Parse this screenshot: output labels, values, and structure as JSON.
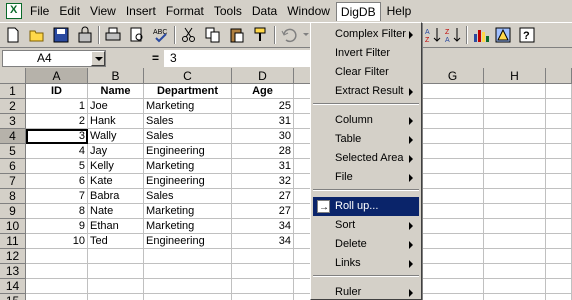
{
  "menubar": {
    "items": [
      "File",
      "Edit",
      "View",
      "Insert",
      "Format",
      "Tools",
      "Data",
      "Window",
      "DigDB",
      "Help"
    ],
    "active_index": 8
  },
  "formula": {
    "cell_ref": "A4",
    "equals": "=",
    "value": "3"
  },
  "grid": {
    "columns": [
      "A",
      "B",
      "C",
      "D",
      "G",
      "H"
    ],
    "rows": [
      "1",
      "2",
      "3",
      "4",
      "5",
      "6",
      "7",
      "8",
      "9",
      "10",
      "11",
      "12",
      "13",
      "14",
      "15"
    ],
    "headers": [
      "ID",
      "Name",
      "Department",
      "Age"
    ],
    "data": [
      [
        "1",
        "Joe",
        "Marketing",
        "25"
      ],
      [
        "2",
        "Hank",
        "Sales",
        "31"
      ],
      [
        "3",
        "Wally",
        "Sales",
        "30"
      ],
      [
        "4",
        "Jay",
        "Engineering",
        "28"
      ],
      [
        "5",
        "Kelly",
        "Marketing",
        "31"
      ],
      [
        "6",
        "Kate",
        "Engineering",
        "32"
      ],
      [
        "7",
        "Babra",
        "Sales",
        "27"
      ],
      [
        "8",
        "Nate",
        "Marketing",
        "27"
      ],
      [
        "9",
        "Ethan",
        "Marketing",
        "34"
      ],
      [
        "10",
        "Ted",
        "Engineering",
        "34"
      ]
    ]
  },
  "dropdown": {
    "items": [
      {
        "label": "Complex Filter",
        "submenu": true
      },
      {
        "label": "Invert Filter",
        "submenu": false
      },
      {
        "label": "Clear Filter",
        "submenu": false
      },
      {
        "label": "Extract Result",
        "submenu": true
      },
      {
        "label": "Column",
        "submenu": true
      },
      {
        "label": "Table",
        "submenu": true
      },
      {
        "label": "Selected Area",
        "submenu": true
      },
      {
        "label": "File",
        "submenu": true
      },
      {
        "label": "Roll up...",
        "submenu": false
      },
      {
        "label": "Sort",
        "submenu": true
      },
      {
        "label": "Delete",
        "submenu": true
      },
      {
        "label": "Links",
        "submenu": true
      },
      {
        "label": "Ruler",
        "submenu": true
      }
    ],
    "highlighted_index": 8
  },
  "colors": {
    "highlight": "#0a246a",
    "chrome": "#d4d0c8"
  }
}
